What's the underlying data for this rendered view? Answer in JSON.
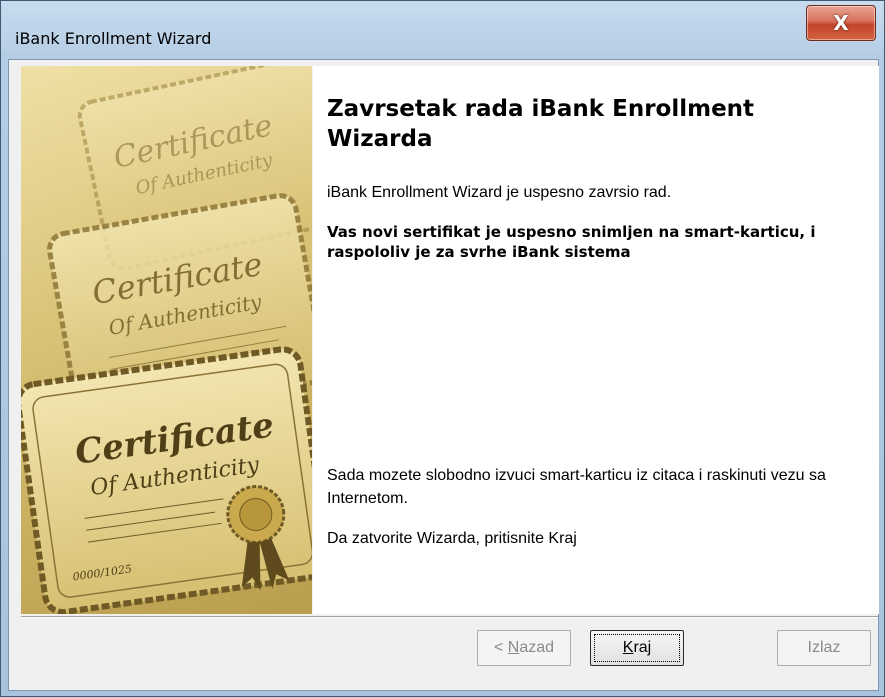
{
  "window": {
    "title": "iBank Enrollment Wizard",
    "close_glyph": "X"
  },
  "content": {
    "heading": "Zavrsetak rada iBank Enrollment Wizarda",
    "line1": "iBank Enrollment Wizard je uspesno zavrsio rad.",
    "line2": "Vas novi sertifikat je uspesno snimljen na smart-karticu, i raspololiv je za svrhe iBank sistema",
    "line3": "Sada mozete slobodno izvuci smart-karticu iz citaca i raskinuti vezu sa Internetom.",
    "line4": "Da zatvorite Wizarda, pritisnite Kraj"
  },
  "side_image": {
    "cert_title": "Certificate",
    "cert_subtitle": "Of Authenticity",
    "serial": "0000/1025"
  },
  "buttons": {
    "back_prefix": "< ",
    "back_mnemonic": "N",
    "back_rest": "azad",
    "finish_mnemonic": "K",
    "finish_rest": "raj",
    "cancel": "Izlaz"
  }
}
